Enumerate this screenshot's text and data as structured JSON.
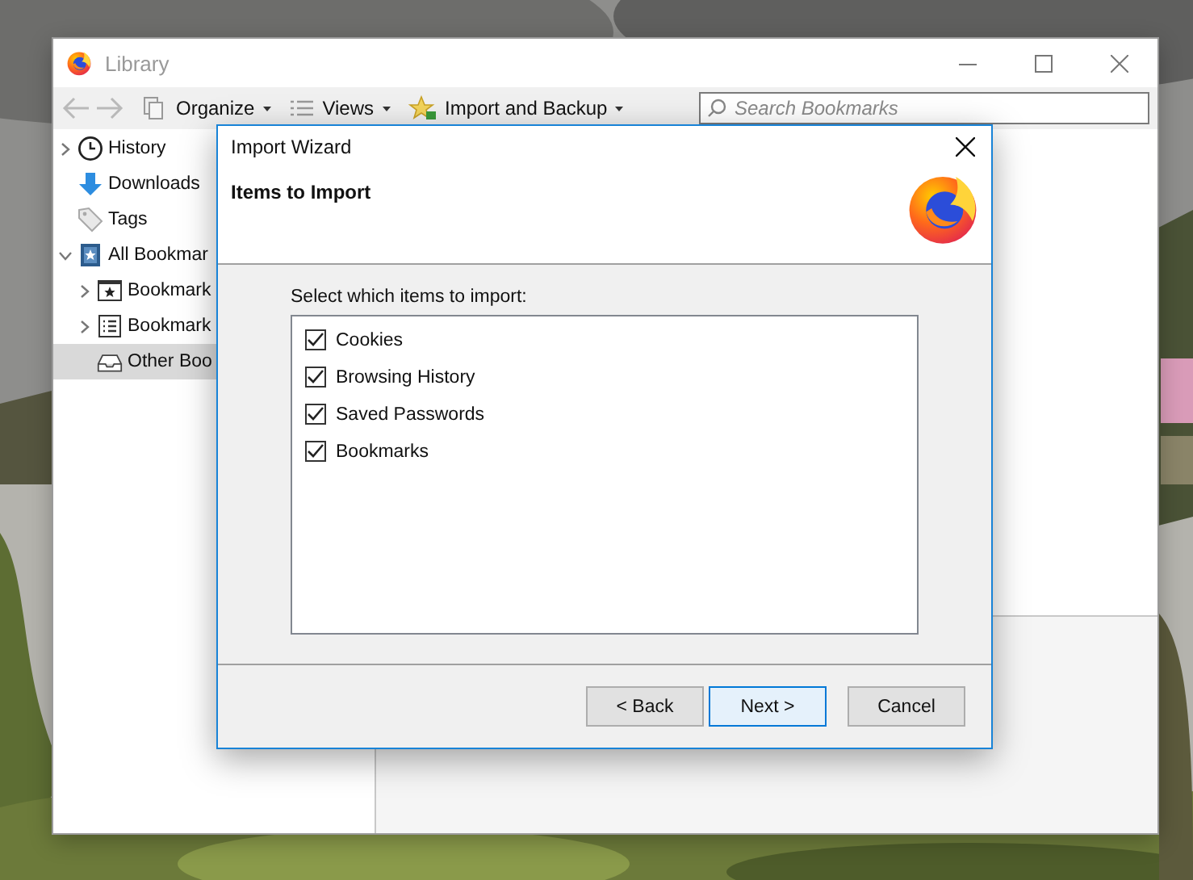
{
  "library_window": {
    "title": "Library",
    "navigation": {
      "back_disabled": true,
      "forward_disabled": true
    },
    "toolbar": [
      {
        "label": "Organize"
      },
      {
        "label": "Views"
      },
      {
        "label": "Import and Backup"
      }
    ],
    "search": {
      "placeholder": "Search Bookmarks"
    },
    "sidebar": {
      "items": [
        {
          "label": "History",
          "kind": "history",
          "expanded": false,
          "selected": false
        },
        {
          "label": "Downloads",
          "kind": "downloads",
          "selected": false
        },
        {
          "label": "Tags",
          "kind": "tags",
          "selected": false
        },
        {
          "label": "All Bookmar",
          "kind": "library",
          "expanded": true,
          "selected": false,
          "children": [
            {
              "label": "Bookmark",
              "kind": "star-folder",
              "expanded": false,
              "selected": false
            },
            {
              "label": "Bookmark",
              "kind": "list-folder",
              "expanded": false,
              "selected": false
            },
            {
              "label": "Other Boo",
              "kind": "tray",
              "selected": true
            }
          ]
        }
      ]
    }
  },
  "dialog": {
    "title": "Import Wizard",
    "heading": "Items to Import",
    "prompt": "Select which items to import:",
    "items": [
      {
        "label": "Cookies",
        "checked": true
      },
      {
        "label": "Browsing History",
        "checked": true
      },
      {
        "label": "Saved Passwords",
        "checked": true
      },
      {
        "label": "Bookmarks",
        "checked": true
      }
    ],
    "buttons": [
      {
        "label": "< Back",
        "default": false
      },
      {
        "label": "Next >",
        "default": true
      },
      {
        "label": "Cancel",
        "default": false
      }
    ]
  }
}
